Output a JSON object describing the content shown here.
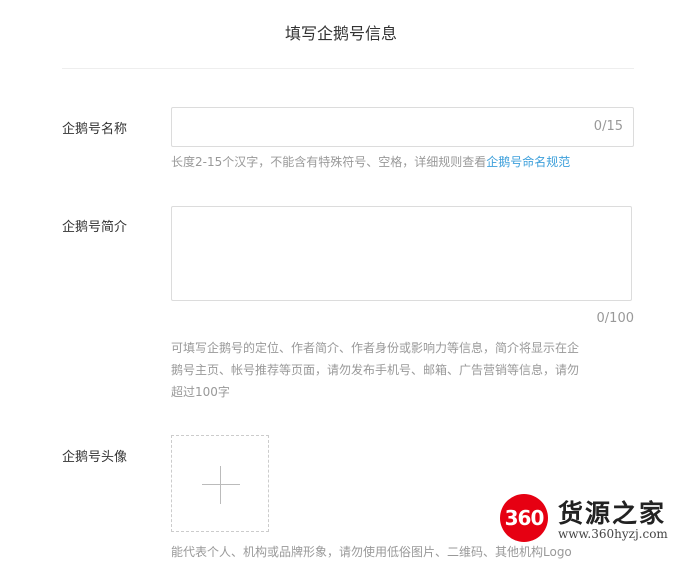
{
  "header": {
    "title": "填写企鹅号信息"
  },
  "name_field": {
    "label": "企鹅号名称",
    "value": "",
    "counter": "0/15",
    "hint_text": "长度2-15个汉字，不能含有特殊符号、空格，详细规则查看",
    "hint_link": "企鹅号命名规范"
  },
  "intro_field": {
    "label": "企鹅号简介",
    "value": "",
    "counter": "0/100",
    "hint_line1": "可填写企鹅号的定位、作者简介、作者身份或影响力等信息，简介将显示在企",
    "hint_line2": "鹅号主页、帐号推荐等页面，请勿发布手机号、邮箱、广告营销等信息，请勿",
    "hint_line3": "超过100字"
  },
  "avatar_field": {
    "label": "企鹅号头像",
    "upload_icon": "plus-icon",
    "hint": "能代表个人、机构或品牌形象，请勿使用低俗图片、二维码、其他机构Logo"
  },
  "watermark": {
    "badge": "360",
    "name": "货源之家",
    "url": "www.360hyzj.com",
    "badge_color": "#e60012"
  }
}
